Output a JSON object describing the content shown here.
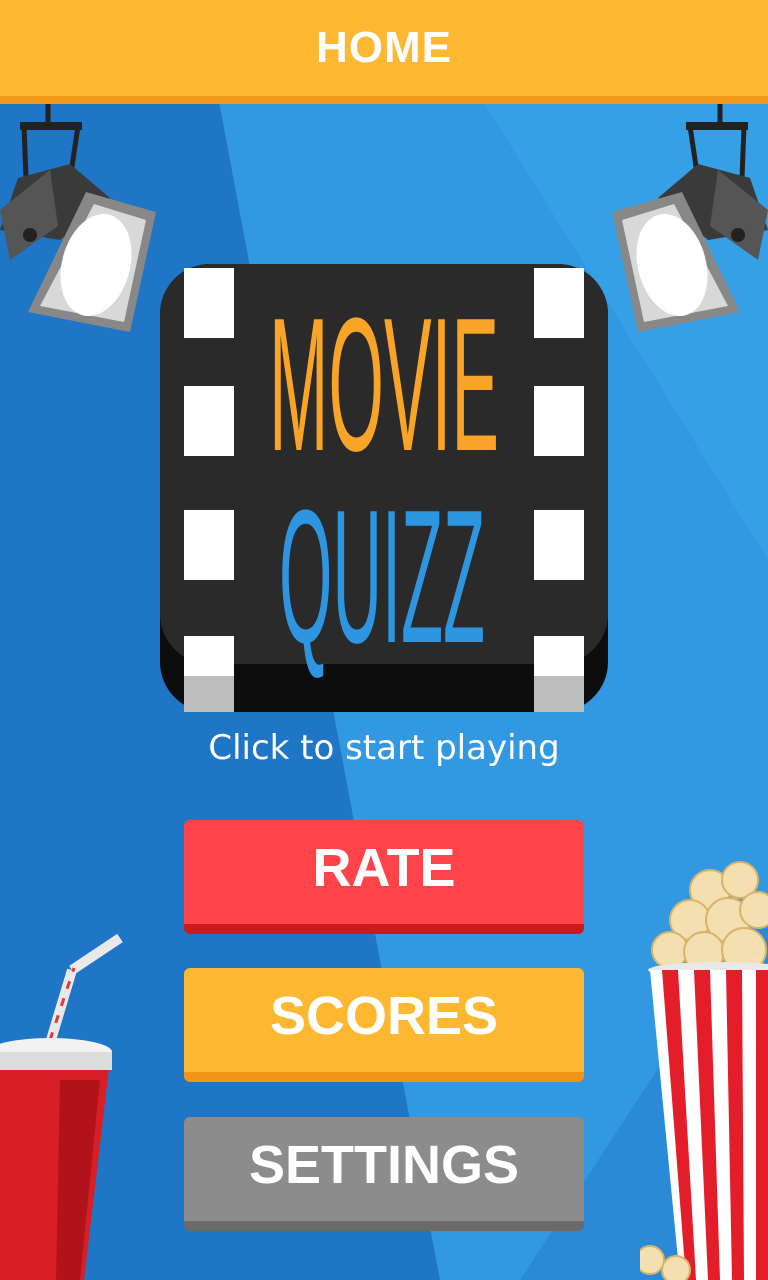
{
  "header": {
    "title": "HOME"
  },
  "logo": {
    "line1": "MOVIE",
    "line2": "QUIZZ"
  },
  "tagline": "Click to start playing",
  "menu": {
    "rate_label": "RATE",
    "scores_label": "SCORES",
    "settings_label": "SETTINGS"
  },
  "colors": {
    "header": "#fdb731",
    "background": "#2a8ad8",
    "rate": "#fe434a",
    "scores": "#fdb731",
    "settings": "#8c8c8c",
    "logo_orange": "#f7a428",
    "logo_blue": "#2e96e1"
  }
}
